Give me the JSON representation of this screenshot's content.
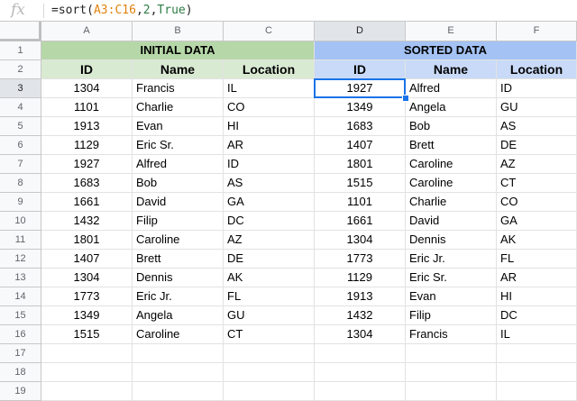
{
  "formula_bar": {
    "icon": "fx-icon",
    "fx_label": "fx",
    "formula_parts": {
      "prefix": "=sort(",
      "range": "A3:C16",
      "comma1": ",",
      "arg2": "2",
      "comma2": ",",
      "arg3": "True",
      "suffix": ")"
    }
  },
  "columns": [
    "A",
    "B",
    "C",
    "D",
    "E",
    "F"
  ],
  "rows": [
    "1",
    "2",
    "3",
    "4",
    "5",
    "6",
    "7",
    "8",
    "9",
    "10",
    "11",
    "12",
    "13",
    "14",
    "15",
    "16",
    "17",
    "18",
    "19"
  ],
  "initial": {
    "title": "INITIAL DATA",
    "headers": [
      "ID",
      "Name",
      "Location"
    ],
    "data": [
      [
        "1304",
        "Francis",
        "IL"
      ],
      [
        "1101",
        "Charlie",
        "CO"
      ],
      [
        "1913",
        "Evan",
        "HI"
      ],
      [
        "1129",
        "Eric Sr.",
        "AR"
      ],
      [
        "1927",
        "Alfred",
        "ID"
      ],
      [
        "1683",
        "Bob",
        "AS"
      ],
      [
        "1661",
        "David",
        "GA"
      ],
      [
        "1432",
        "Filip",
        "DC"
      ],
      [
        "1801",
        "Caroline",
        "AZ"
      ],
      [
        "1407",
        "Brett",
        "DE"
      ],
      [
        "1304",
        "Dennis",
        "AK"
      ],
      [
        "1773",
        "Eric Jr.",
        "FL"
      ],
      [
        "1349",
        "Angela",
        "GU"
      ],
      [
        "1515",
        "Caroline",
        "CT"
      ]
    ]
  },
  "sorted": {
    "title": "SORTED DATA",
    "headers": [
      "ID",
      "Name",
      "Location"
    ],
    "data": [
      [
        "1927",
        "Alfred",
        "ID"
      ],
      [
        "1349",
        "Angela",
        "GU"
      ],
      [
        "1683",
        "Bob",
        "AS"
      ],
      [
        "1407",
        "Brett",
        "DE"
      ],
      [
        "1801",
        "Caroline",
        "AZ"
      ],
      [
        "1515",
        "Caroline",
        "CT"
      ],
      [
        "1101",
        "Charlie",
        "CO"
      ],
      [
        "1661",
        "David",
        "GA"
      ],
      [
        "1304",
        "Dennis",
        "AK"
      ],
      [
        "1773",
        "Eric Jr.",
        "FL"
      ],
      [
        "1129",
        "Eric Sr.",
        "AR"
      ],
      [
        "1913",
        "Evan",
        "HI"
      ],
      [
        "1432",
        "Filip",
        "DC"
      ],
      [
        "1304",
        "Francis",
        "IL"
      ]
    ]
  },
  "active_cell": "D3",
  "colors": {
    "green_title": "#b6d7a8",
    "green_header": "#d9ead3",
    "blue_title": "#a4c2f4",
    "blue_header": "#c9daf8",
    "selection": "#1a73e8"
  }
}
